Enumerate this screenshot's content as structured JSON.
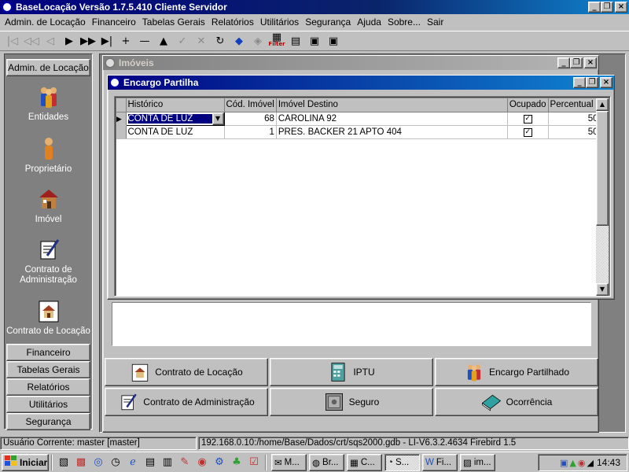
{
  "app": {
    "title": "BaseLocação Versão 1.7.5.410 Cliente Servidor",
    "window_buttons": [
      "_",
      "❐",
      "×"
    ]
  },
  "menu": [
    "Admin. de Locação",
    "Financeiro",
    "Tabelas Gerais",
    "Relatórios",
    "Utilitários",
    "Segurança",
    "Ajuda",
    "Sobre...",
    "Sair"
  ],
  "toolbar": [
    {
      "icon": "first-record-icon",
      "glyph": "|◁"
    },
    {
      "icon": "prior-page-icon",
      "glyph": "◁◁"
    },
    {
      "icon": "prior-record-icon",
      "glyph": "◁"
    },
    {
      "icon": "next-record-icon",
      "glyph": "▶"
    },
    {
      "icon": "next-page-icon",
      "glyph": "▶▶"
    },
    {
      "icon": "last-record-icon",
      "glyph": "▶|"
    },
    {
      "icon": "insert-icon",
      "glyph": "+"
    },
    {
      "icon": "delete-icon",
      "glyph": "—"
    },
    {
      "icon": "edit-icon",
      "glyph": "▲"
    },
    {
      "icon": "post-icon",
      "glyph": "✓"
    },
    {
      "icon": "cancel-icon",
      "glyph": "✕"
    },
    {
      "icon": "refresh-icon",
      "glyph": "↻"
    },
    {
      "icon": "clear-icon",
      "glyph": "◆"
    },
    {
      "icon": "disk-icon",
      "glyph": "◈"
    },
    {
      "icon": "filter-icon",
      "glyph": "▦",
      "label": "Filter"
    },
    {
      "icon": "report-icon",
      "glyph": "▤"
    },
    {
      "icon": "print-icon",
      "glyph": "▣"
    },
    {
      "icon": "preview-icon",
      "glyph": "▣"
    }
  ],
  "sidebar": {
    "header": "Admin. de Locação",
    "items": [
      {
        "label": "Entidades",
        "icon": "people-icon"
      },
      {
        "label": "Proprietário",
        "icon": "person-icon"
      },
      {
        "label": "Imóvel",
        "icon": "house-icon"
      },
      {
        "label": "Contrato de Administração",
        "icon": "contract-pen-icon"
      },
      {
        "label": "Contrato de Locação",
        "icon": "house-contract-icon"
      }
    ],
    "sections": [
      "Financeiro",
      "Tabelas Gerais",
      "Relatórios",
      "Utilitários",
      "Segurança"
    ]
  },
  "imoveis_window": {
    "title": "Imóveis"
  },
  "encargo_window": {
    "title": "Encargo Partilha",
    "columns": [
      "Histórico",
      "Cód. Imóvel",
      "Imóvel Destino",
      "Ocupado",
      "Percentual"
    ],
    "rows": [
      {
        "historico": "CONTA DE LUZ",
        "cod": "68",
        "destino": "CAROLINA 92",
        "ocupado": true,
        "percentual": "50"
      },
      {
        "historico": "CONTA DE LUZ",
        "cod": "1",
        "destino": "PRES. BACKER 21 APTO 404",
        "ocupado": true,
        "percentual": "50"
      }
    ]
  },
  "action_buttons": [
    {
      "label": "Contrato de Locação",
      "icon": "house-contract-icon"
    },
    {
      "label": "IPTU",
      "icon": "calculator-icon"
    },
    {
      "label": "Encargo Partilhado",
      "icon": "people-icon"
    },
    {
      "label": "Contrato de Administração",
      "icon": "contract-pen-icon"
    },
    {
      "label": "Seguro",
      "icon": "safe-icon"
    },
    {
      "label": "Ocorrência",
      "icon": "book-icon"
    }
  ],
  "status": {
    "user": "Usuário Corrente:  master [master]",
    "connection": "192.168.0.10:/home/Base/Dados/crt/sqs2000.gdb - LI-V6.3.2.4634 Firebird 1.5"
  },
  "taskbar": {
    "start": "Iniciar",
    "tasks": [
      {
        "label": "M...",
        "icon": "mail-icon"
      },
      {
        "label": "Br...",
        "icon": "browser-icon"
      },
      {
        "label": "C...",
        "icon": "explorer-icon"
      },
      {
        "label": "S...",
        "icon": "baselocacao-icon",
        "active": true
      },
      {
        "label": "Fi...",
        "icon": "word-icon"
      },
      {
        "label": "im...",
        "icon": "image-icon"
      }
    ],
    "clock": "14:43"
  }
}
